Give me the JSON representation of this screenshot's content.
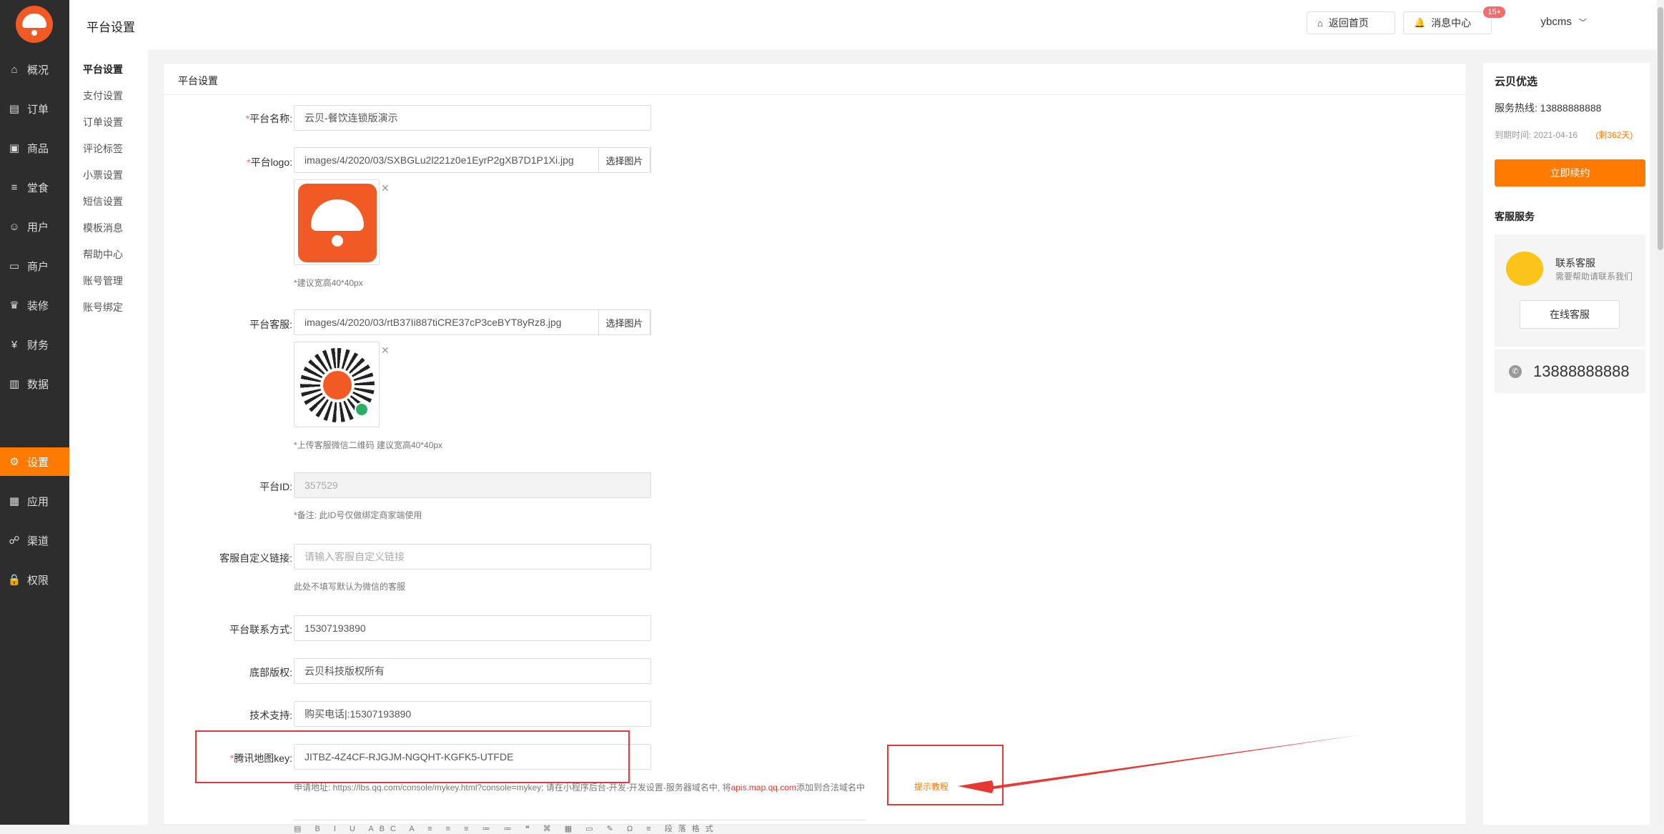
{
  "sidebar": {
    "items": [
      {
        "label": "概况",
        "icon": "home-icon",
        "glyph": "⌂"
      },
      {
        "label": "订单",
        "icon": "order-icon",
        "glyph": "▤"
      },
      {
        "label": "商品",
        "icon": "goods-icon",
        "glyph": "▣"
      },
      {
        "label": "堂食",
        "icon": "dine-icon",
        "glyph": "≡"
      },
      {
        "label": "用户",
        "icon": "user-icon",
        "glyph": "☺"
      },
      {
        "label": "商户",
        "icon": "shop-icon",
        "glyph": "▭"
      },
      {
        "label": "装修",
        "icon": "decor-icon",
        "glyph": "♛"
      },
      {
        "label": "财务",
        "icon": "finance-icon",
        "glyph": "¥"
      },
      {
        "label": "数据",
        "icon": "data-icon",
        "glyph": "▥"
      },
      {
        "label": "设置",
        "icon": "settings-icon",
        "glyph": "⚙"
      },
      {
        "label": "应用",
        "icon": "apps-icon",
        "glyph": "▦"
      },
      {
        "label": "渠道",
        "icon": "channel-icon",
        "glyph": "☍"
      },
      {
        "label": "权限",
        "icon": "lock-icon",
        "glyph": "🔒"
      }
    ],
    "active_color": "#ff7a00"
  },
  "submenu": [
    "平台设置",
    "支付设置",
    "订单设置",
    "评论标签",
    "小票设置",
    "短信设置",
    "模板消息",
    "帮助中心",
    "账号管理",
    "账号绑定"
  ],
  "header": {
    "title": "平台设置",
    "home_btn": "返回首页",
    "msg_btn": "消息中心",
    "msg_badge": "15+",
    "user": "ybcms"
  },
  "form": {
    "card_title": "平台设置",
    "name_label": "平台名称:",
    "name_value": "云贝-餐饮连锁版演示",
    "logo_label": "平台logo:",
    "logo_value": "images/4/2020/03/SXBGLu2l221z0e1EyrP2gXB7D1P1Xi.jpg",
    "pick_label": "选择图片",
    "logo_hint": "*建议宽高40*40px",
    "service_label": "平台客服:",
    "service_value": "images/4/2020/03/rtB37Ii887tiCRE37cP3ceBYT8yRz8.jpg",
    "service_hint": "*上传客服微信二维码 建议宽高40*40px",
    "id_label": "平台ID:",
    "id_value": "357529",
    "id_hint": "*备注: 此ID号仅做绑定商家端使用",
    "link_label": "客服自定义链接:",
    "link_placeholder": "请输入客服自定义链接",
    "link_hint": "此处不填写默认为微信的客服",
    "contact_label": "平台联系方式:",
    "contact_value": "15307193890",
    "copyright_label": "底部版权:",
    "copyright_value": "云贝科技版权所有",
    "support_label": "技术支持:",
    "support_value": "购买电话|:15307193890",
    "mapkey_label": "腾讯地图key:",
    "mapkey_value": "JITBZ-4Z4CF-RJGJM-NGQHT-KGFK5-UTFDE",
    "apply_hint_pre": "申请地址: https://lbs.qq.com/console/mykey.html?console=mykey; 请在小程序后台-开发-开发设置-服务器域名中, 将",
    "apply_hint_domain": "apis.map.qq.com",
    "apply_hint_post": "添加到合法域名中",
    "tutorial_link": "提示教程",
    "toolbar_glyphs": "▤ B I U ABC A ≡ ≡ ≡ ≔ ≔ ❝ ⌘ ▦ ▭ ✎ Ω ≡ 段落格式"
  },
  "right_panel": {
    "title": "云贝优选",
    "hotline": "服务热线: 13888888888",
    "expire_label": "到期时间: 2021-04-16",
    "remaining": "(剩362天)",
    "renew_btn": "立即续约",
    "service_title": "客服服务",
    "contact_name": "联系客服",
    "contact_desc": "需要帮助请联系我们",
    "online_btn": "在线客服",
    "phone": "13888888888"
  }
}
